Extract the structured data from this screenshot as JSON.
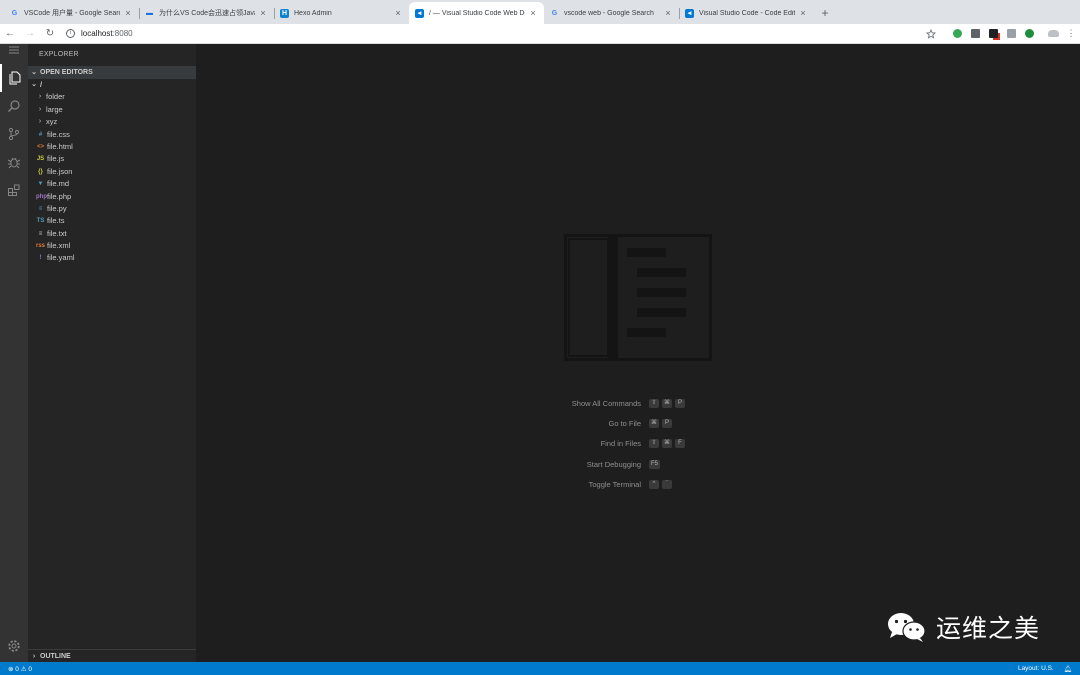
{
  "browser": {
    "tabs": [
      {
        "favicon": "google-icon",
        "title": "VSCode 用户量 - Google Search",
        "active": false
      },
      {
        "favicon": "page-icon",
        "title": "为什么VS Code会迅速占领JavaScript",
        "active": false
      },
      {
        "favicon": "hexo-icon",
        "title": "Hexo Admin",
        "active": false
      },
      {
        "favicon": "vscode-icon",
        "title": "/ — Visual Studio Code Web Dev",
        "active": true
      },
      {
        "favicon": "google-icon",
        "title": "vscode web - Google Search",
        "active": false
      },
      {
        "favicon": "vscode-icon",
        "title": "Visual Studio Code - Code Editing",
        "active": false
      }
    ],
    "url_host": "localhost",
    "url_port": ":8080"
  },
  "sidebar": {
    "title": "EXPLORER",
    "open_editors": "OPEN EDITORS",
    "root": "/",
    "folders": [
      "folder",
      "large",
      "xyz"
    ],
    "files": [
      {
        "name": "file.css",
        "icon": "css-icon",
        "glyph": "#",
        "color": "#519aba"
      },
      {
        "name": "file.html",
        "icon": "html-icon",
        "glyph": "<>",
        "color": "#e37933"
      },
      {
        "name": "file.js",
        "icon": "js-icon",
        "glyph": "JS",
        "color": "#cbcb41"
      },
      {
        "name": "file.json",
        "icon": "json-icon",
        "glyph": "{}",
        "color": "#cbcb41"
      },
      {
        "name": "file.md",
        "icon": "markdown-icon",
        "glyph": "▼",
        "color": "#519aba"
      },
      {
        "name": "file.php",
        "icon": "php-icon",
        "glyph": "php",
        "color": "#a074c4"
      },
      {
        "name": "file.py",
        "icon": "python-icon",
        "glyph": "≡",
        "color": "#519aba"
      },
      {
        "name": "file.ts",
        "icon": "typescript-icon",
        "glyph": "TS",
        "color": "#519aba"
      },
      {
        "name": "file.txt",
        "icon": "text-icon",
        "glyph": "≡",
        "color": "#cccccc"
      },
      {
        "name": "file.xml",
        "icon": "xml-icon",
        "glyph": "rss",
        "color": "#e37933"
      },
      {
        "name": "file.yaml",
        "icon": "yaml-icon",
        "glyph": "!",
        "color": "#a074c4"
      }
    ],
    "outline": "OUTLINE"
  },
  "editor": {
    "shortcuts": [
      {
        "label": "Show All Commands",
        "keys": [
          "⇧",
          "⌘",
          "P"
        ]
      },
      {
        "label": "Go to File",
        "keys": [
          "⌘",
          "P"
        ]
      },
      {
        "label": "Find in Files",
        "keys": [
          "⇧",
          "⌘",
          "F"
        ]
      },
      {
        "label": "Start Debugging",
        "keys": [
          "F5"
        ]
      },
      {
        "label": "Toggle Terminal",
        "keys": [
          "^",
          "`"
        ]
      }
    ]
  },
  "watermark_brand": "运维之美",
  "statusbar": {
    "errors": "0",
    "warnings": "0",
    "layout": "Layout: U.S."
  },
  "colors": {
    "statusbar": "#007acc",
    "activitybar": "#333333",
    "sidebar": "#252526",
    "editor": "#1e1e1e"
  }
}
